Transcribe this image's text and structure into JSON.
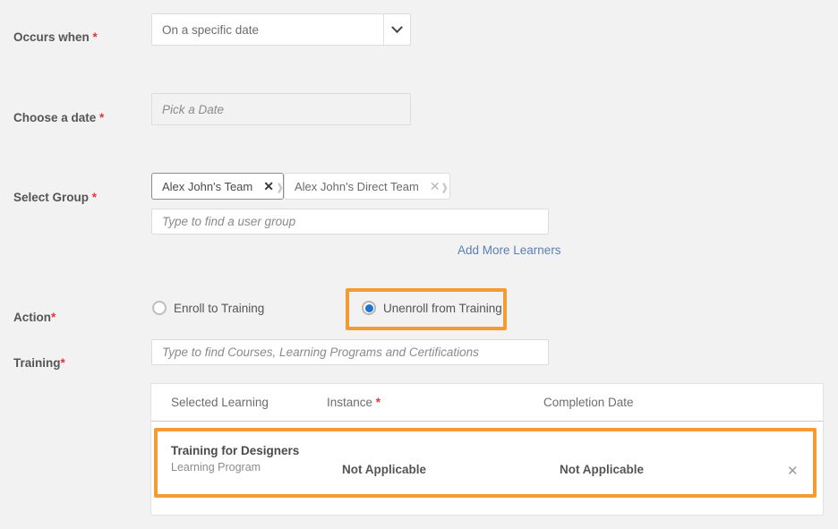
{
  "theme": {
    "page_bg": "#f2f2f2",
    "accent_highlight": "#f59b33",
    "link_color": "#5b7fb5",
    "required_color": "#e8323c",
    "radio_selected_color": "#1f73d4"
  },
  "fields": {
    "occurs_when": {
      "label": "Occurs when ",
      "required_mark": "*",
      "selected_option": "On a specific date",
      "chevron_icon": "chevron-down-icon"
    },
    "choose_date": {
      "label": "Choose a date ",
      "required_mark": "*",
      "placeholder": "Pick a Date",
      "value": ""
    },
    "select_group": {
      "label": "Select Group ",
      "required_mark": "*",
      "tags": [
        {
          "name": "Alex John's Team",
          "remove_icon": "close-icon"
        },
        {
          "name": "Alex John's Direct Team",
          "remove_icon": "close-icon"
        }
      ],
      "search_placeholder": "Type to find a user group",
      "search_value": "",
      "add_more_link": "Add More Learners"
    },
    "action": {
      "label": "Action",
      "required_mark": "*",
      "options": [
        {
          "label": "Enroll to Training",
          "selected": false
        },
        {
          "label": "Unenroll from Training",
          "selected": true
        }
      ]
    },
    "training": {
      "label": "Training",
      "required_mark": "*",
      "placeholder": "Type to find Courses, Learning Programs and Certifications",
      "value": ""
    }
  },
  "table": {
    "columns": [
      {
        "label": "Selected Learning",
        "required_mark": ""
      },
      {
        "label": "Instance ",
        "required_mark": "*"
      },
      {
        "label": "Completion Date",
        "required_mark": ""
      }
    ],
    "rows": [
      {
        "title": "Training for Designers",
        "subtitle": "Learning Program",
        "instance": "Not Applicable",
        "completion_date": "Not Applicable",
        "remove_icon": "close-icon"
      }
    ]
  }
}
